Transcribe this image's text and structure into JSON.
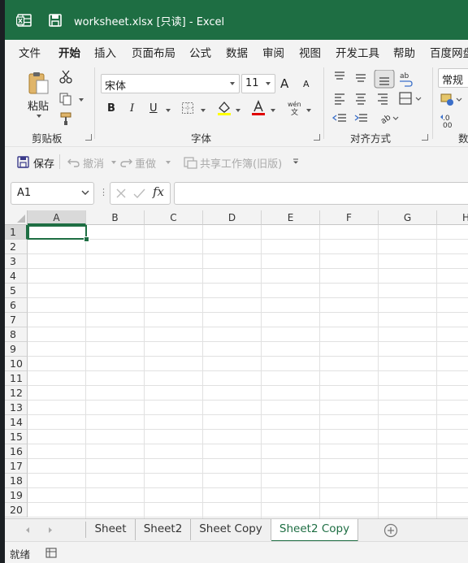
{
  "window": {
    "title": "worksheet.xlsx  [只读]  -  Excel"
  },
  "menu": {
    "items": [
      "文件",
      "开始",
      "插入",
      "页面布局",
      "公式",
      "数据",
      "审阅",
      "视图",
      "开发工具",
      "帮助",
      "百度网盘"
    ],
    "active": "开始"
  },
  "ribbon": {
    "clipboard": {
      "paste": "粘贴",
      "label": "剪贴板"
    },
    "font": {
      "name": "宋体",
      "size": "11",
      "label": "字体",
      "bold": "B",
      "italic": "I",
      "underline": "U",
      "grow": "A",
      "shrink": "A"
    },
    "alignment": {
      "label": "对齐方式"
    },
    "number": {
      "format": "常规",
      "label": "数"
    },
    "colors": {
      "highlight": "#ffff00",
      "font_color": "#e00000"
    }
  },
  "quick_access": {
    "save": "保存",
    "undo": "撤消",
    "redo": "重做",
    "share": "共享工作簿(旧版)"
  },
  "formula_bar": {
    "name_box": "A1",
    "fx": "fx",
    "value": ""
  },
  "grid": {
    "columns": [
      "A",
      "B",
      "C",
      "D",
      "E",
      "F",
      "G",
      "H"
    ],
    "rows": [
      "1",
      "2",
      "3",
      "4",
      "5",
      "6",
      "7",
      "8",
      "9",
      "10",
      "11",
      "12",
      "13",
      "14",
      "15",
      "16",
      "17",
      "18",
      "19",
      "20"
    ],
    "active_cell": "A1"
  },
  "sheets": {
    "tabs": [
      "Sheet",
      "Sheet2",
      "Sheet Copy",
      "Sheet2 Copy"
    ],
    "active": "Sheet2 Copy"
  },
  "status": {
    "text": "就绪"
  }
}
